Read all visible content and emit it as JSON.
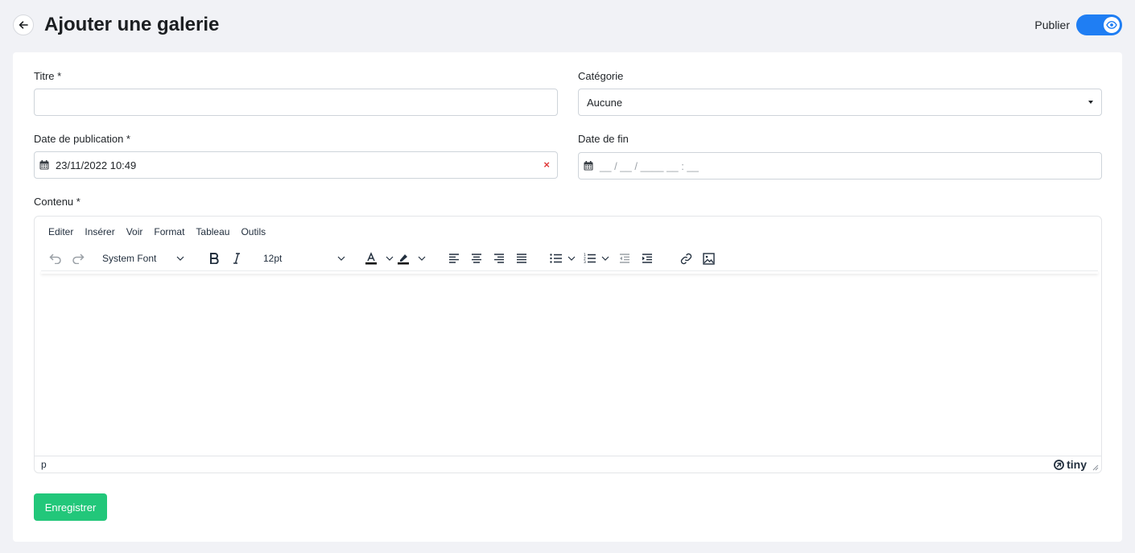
{
  "header": {
    "title": "Ajouter une galerie",
    "publish_label": "Publier",
    "publish_on": true
  },
  "form": {
    "title_label": "Titre *",
    "title_value": "",
    "category_label": "Catégorie",
    "category_value": "Aucune",
    "pub_date_label": "Date de publication *",
    "pub_date_value": "23/11/2022 10:49",
    "end_date_label": "Date de fin",
    "end_date_placeholder": "__ / __ / ____ __ : __",
    "content_label": "Contenu *"
  },
  "editor": {
    "menu": [
      "Editer",
      "Insérer",
      "Voir",
      "Format",
      "Tableau",
      "Outils"
    ],
    "font_family": "System Font",
    "font_size": "12pt",
    "status_path": "p",
    "brand": "tiny"
  },
  "actions": {
    "save_label": "Enregistrer"
  },
  "colors": {
    "accent": "#1f7ef3",
    "save": "#22c77a",
    "clear": "#e03a3a"
  }
}
